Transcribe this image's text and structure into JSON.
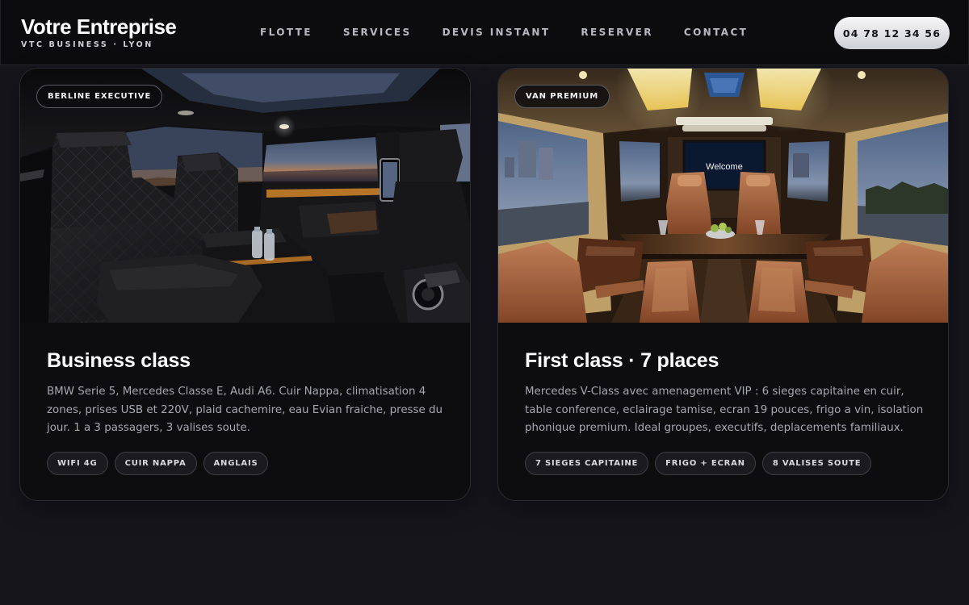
{
  "header": {
    "brand_name": "Votre Entreprise",
    "brand_tagline": "VTC BUSINESS · LYON",
    "nav": [
      {
        "label": "FLOTTE"
      },
      {
        "label": "SERVICES"
      },
      {
        "label": "DEVIS INSTANT"
      },
      {
        "label": "RESERVER"
      },
      {
        "label": "CONTACT"
      }
    ],
    "phone": "04 78 12 34 56"
  },
  "cards": [
    {
      "badge": "BERLINE EXECUTIVE",
      "image": "luxury-sedan-rear-interior-photo",
      "title": "Business class",
      "description": "BMW Serie 5, Mercedes Classe E, Audi A6. Cuir Nappa, climatisation 4 zones, prises USB et 220V, plaid cachemire, eau Evian fraiche, presse du jour. 1 a 3 passagers, 3 valises soute.",
      "chips": [
        "WIFI 4G",
        "CUIR NAPPA",
        "ANGLAIS"
      ]
    },
    {
      "badge": "VAN PREMIUM",
      "image": "vip-van-lounge-interior-photo",
      "screen_text": "Welcome",
      "title": "First class · 7 places",
      "description": "Mercedes V-Class avec amenagement VIP : 6 sieges capitaine en cuir, table conference, eclairage tamise, ecran 19 pouces, frigo a vin, isolation phonique premium. Ideal groupes, executifs, deplacements familiaux.",
      "chips": [
        "7 SIEGES CAPITAINE",
        "FRIGO + ECRAN",
        "8 VALISES SOUTE"
      ]
    }
  ],
  "colors": {
    "page_bg": "#16151c",
    "card_bg": "#0d0d10",
    "leather_black": "#1b1b1e",
    "leather_tan": "#b5724a",
    "ambient_amber": "#e59a3a"
  }
}
